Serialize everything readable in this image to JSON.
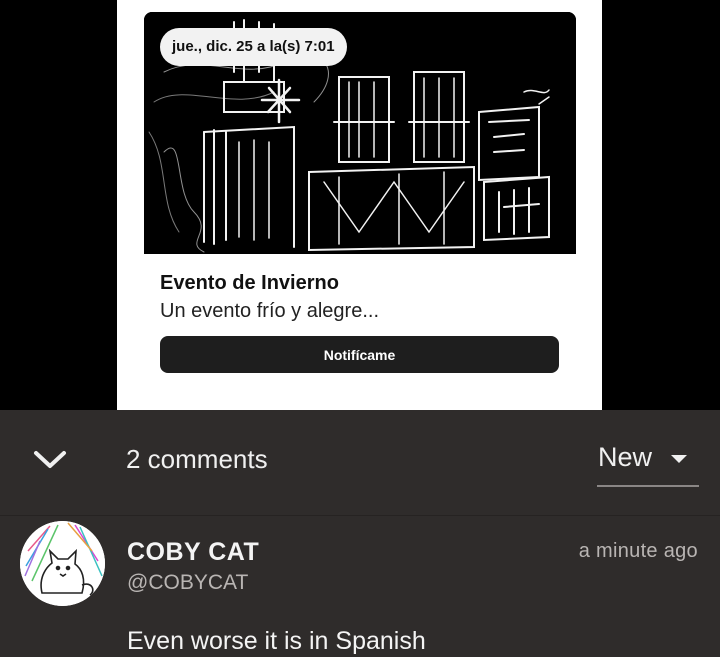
{
  "event": {
    "date_time": "jue., dic. 25 a la(s) 7:01",
    "title": "Evento de Invierno",
    "subtitle": "Un evento frío y alegre...",
    "notify_label": "Notifícame"
  },
  "comments_panel": {
    "count_label": "2 comments",
    "sort_label": "New"
  },
  "comments": [
    {
      "author": "COBY CAT",
      "handle": "@COBYCAT",
      "time": "a minute ago",
      "text": "Even worse it is in Spanish"
    }
  ]
}
